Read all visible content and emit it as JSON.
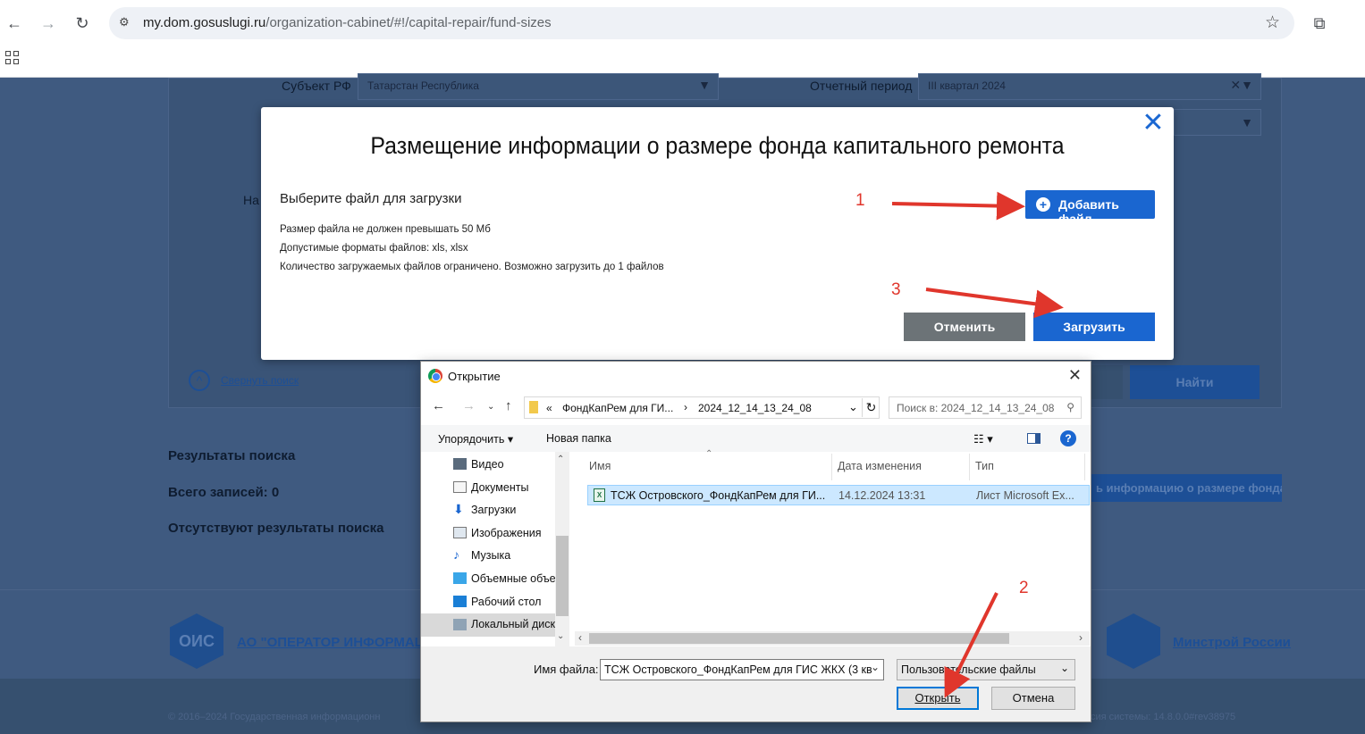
{
  "browser": {
    "url_host": "my.dom.gosuslugi.ru",
    "url_path": "/organization-cabinet/#!/capital-repair/fund-sizes"
  },
  "background": {
    "subject_label": "Субъект РФ",
    "subject_value": "Татарстан Республика",
    "period_label": "Отчетный период",
    "period_value": "III квартал 2024",
    "partial_label": "На",
    "collapse_search": "Свернуть поиск",
    "find_button": "Найти",
    "results_title": "Результаты поиска",
    "total_records": "Всего записей: 0",
    "no_results": "Отсутствуют результаты поиска",
    "add_fund_button": "ь информацию о размере фонда",
    "footer_operator": "АО \"ОПЕРАТОР ИНФОРМАЦИ",
    "footer_ministry": "Минстрой России",
    "footer_logo": "ОИС",
    "copyright": "© 2016–2024 Государственная информационн",
    "version": "сия системы: 14.8.0.0#rev38975"
  },
  "modal": {
    "title": "Размещение информации о размере фонда капитального ремонта",
    "choose_file": "Выберите файл для загрузки",
    "hints": [
      "Размер файла не должен превышать 50 Мб",
      "Допустимые форматы файлов: xls, xlsx",
      "Количество загружаемых файлов ограничено. Возможно загрузить до 1 файлов"
    ],
    "add_file": "Добавить файл",
    "cancel": "Отменить",
    "upload": "Загрузить"
  },
  "dialog": {
    "title": "Открытие",
    "breadcrumb": [
      "«",
      "ФондКапРем для ГИ...",
      "›",
      "2024_12_14_13_24_08"
    ],
    "search_placeholder": "Поиск в: 2024_12_14_13_24_08",
    "organize": "Упорядочить ▾",
    "new_folder": "Новая папка",
    "sidebar": [
      "Видео",
      "Документы",
      "Загрузки",
      "Изображения",
      "Музыка",
      "Объемные объекты",
      "Рабочий стол",
      "Локальный диск"
    ],
    "columns": [
      "Имя",
      "Дата изменения",
      "Тип"
    ],
    "file": {
      "name": "ТСЖ Островского_ФондКапРем для ГИ...",
      "date": "14.12.2024 13:31",
      "type": "Лист Microsoft Ex..."
    },
    "file_name_label": "Имя файла:",
    "file_name_value": "ТСЖ Островского_ФондКапРем для ГИС ЖКХ (3 кв",
    "file_type": "Пользовательские файлы",
    "open": "Открыть",
    "cancel": "Отмена"
  },
  "annotations": [
    "1",
    "2",
    "3"
  ],
  "colors": {
    "primary": "#1a66d0",
    "annotation": "#e0362c",
    "dim_bg": "#3f5a80"
  }
}
